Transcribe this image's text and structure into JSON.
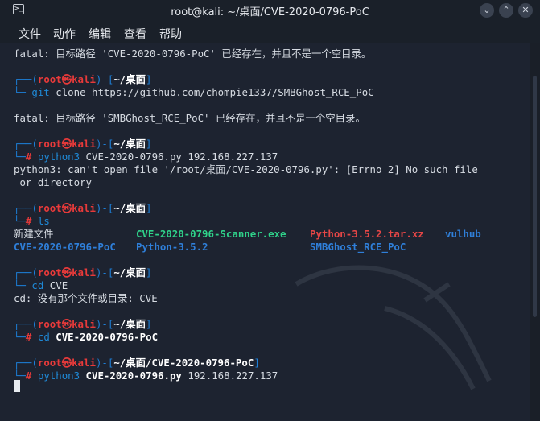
{
  "window": {
    "title": "root@kali: ~/桌面/CVE-2020-0796-PoC",
    "terminal_icon": "terminal-icon",
    "minimize_icon": "minimize-icon",
    "maximize_icon": "maximize-icon",
    "close_icon": "close-icon"
  },
  "menu": [
    "文件",
    "动作",
    "编辑",
    "查看",
    "帮助"
  ],
  "prompt": {
    "open_paren": "(",
    "user": "root",
    "skull": "㉿",
    "host": "kali",
    "close_paren": ")-[",
    "path_home": "~/桌面",
    "path_sub": "/CVE-2020-0796-PoC",
    "close_bracket": "]",
    "corner": "└─",
    "hash": "#"
  },
  "lines": {
    "l1": "fatal: 目标路径 'CVE-2020-0796-PoC' 已经存在，并且不是一个空目录。",
    "cmd1_a": "git",
    "cmd1_b": " clone https://github.com/chompie1337/SMBGhost_RCE_PoC",
    "l3": "fatal: 目标路径 'SMBGhost_RCE_PoC' 已经存在，并且不是一个空目录。",
    "cmd2_a": "python3",
    "cmd2_b": " CVE-2020-0796.py 192.168.227.137",
    "l5a": "python3: can't open file '/root/桌面/CVE-2020-0796.py': [Errno 2] No such file",
    "l5b": " or directory",
    "cmd3": "ls",
    "ls_row1": [
      "新建文件",
      "CVE-2020-0796-Scanner.exe",
      "Python-3.5.2.tar.xz",
      "vulhub"
    ],
    "ls_row2": [
      "CVE-2020-0796-PoC",
      "Python-3.5.2",
      "SMBGhost_RCE_PoC"
    ],
    "cmd4_a": "cd",
    "cmd4_b": " CVE",
    "l7": "cd: 没有那个文件或目录: CVE",
    "cmd5_a": "cd",
    "cmd5_b": " CVE-2020-0796-PoC",
    "cmd6_a": "python3",
    "cmd6_b": " CVE-2020-0796.py",
    "cmd6_c": " 192.168.227.137"
  },
  "colors": {
    "background": "#1d2330",
    "prompt_blue": "#1d7fd8",
    "prompt_red": "#e83a3a",
    "directory_blue": "#2f7fd9",
    "exe_green": "#2fd28a",
    "archive_red": "#e54646"
  }
}
